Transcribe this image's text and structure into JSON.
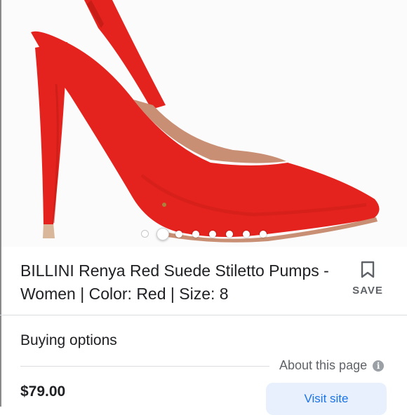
{
  "product": {
    "title": "BILLINI Renya Red Suede Stiletto Pumps - Women | Color: Red | Size: 8",
    "price": "$79.00"
  },
  "carousel": {
    "total_dots": 8,
    "active_index": 1
  },
  "actions": {
    "save_label": "SAVE",
    "visit_label": "Visit site"
  },
  "buying": {
    "heading": "Buying options",
    "about_label": "About this page",
    "info_glyph": "i"
  },
  "colors": {
    "shoe_red": "#e5231e",
    "link_blue": "#1a73e8",
    "button_bg": "#e8f0fe",
    "muted_text": "#5f6368"
  },
  "icons": [
    "bookmark-icon",
    "info-icon"
  ]
}
